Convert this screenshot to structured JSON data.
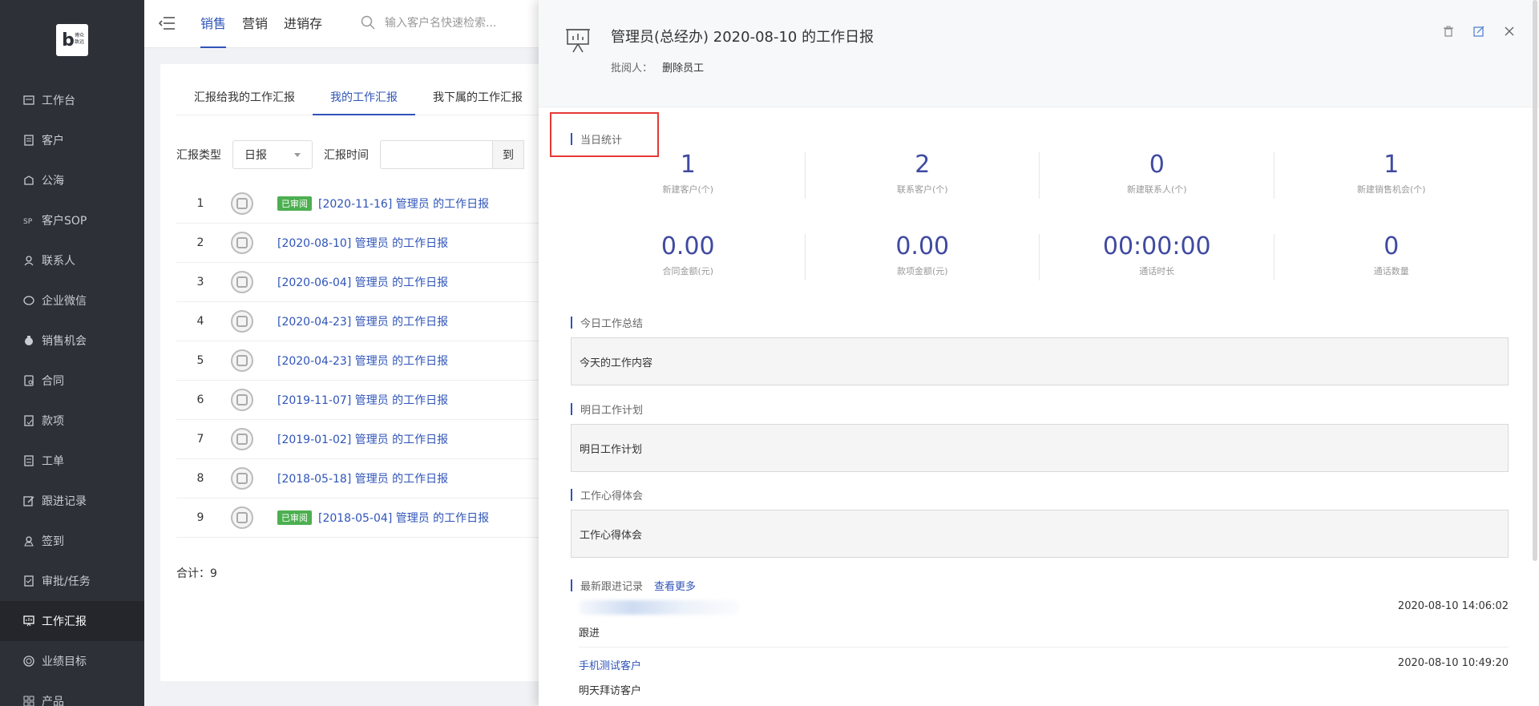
{
  "sidebar": {
    "logo_text": "博众致远",
    "items": [
      {
        "label": "工作台",
        "icon": "workbench-icon"
      },
      {
        "label": "客户",
        "icon": "customer-icon"
      },
      {
        "label": "公海",
        "icon": "pool-icon"
      },
      {
        "label": "客户SOP",
        "icon": "sop-icon"
      },
      {
        "label": "联系人",
        "icon": "contact-icon"
      },
      {
        "label": "企业微信",
        "icon": "wechat-icon"
      },
      {
        "label": "销售机会",
        "icon": "opportunity-icon"
      },
      {
        "label": "合同",
        "icon": "contract-icon"
      },
      {
        "label": "款项",
        "icon": "payment-icon"
      },
      {
        "label": "工单",
        "icon": "ticket-icon"
      },
      {
        "label": "跟进记录",
        "icon": "followup-icon"
      },
      {
        "label": "签到",
        "icon": "checkin-icon"
      },
      {
        "label": "审批/任务",
        "icon": "approval-icon"
      },
      {
        "label": "工作汇报",
        "icon": "report-icon"
      },
      {
        "label": "业绩目标",
        "icon": "target-icon"
      },
      {
        "label": "产品",
        "icon": "product-icon"
      }
    ],
    "active_index": 13
  },
  "topbar": {
    "tabs": [
      "销售",
      "营销",
      "进销存"
    ],
    "active_tab": 0,
    "search_placeholder": "输入客户名快速检索..."
  },
  "content": {
    "sub_tabs": [
      "汇报给我的工作汇报",
      "我的工作汇报",
      "我下属的工作汇报"
    ],
    "active_sub_tab": 1,
    "filter_type_label": "汇报类型",
    "filter_type_value": "日报",
    "filter_time_label": "汇报时间",
    "date_to": "到",
    "reports": [
      {
        "index": "1",
        "badge": "已审阅",
        "title": "[2020-11-16] 管理员 的工作日报"
      },
      {
        "index": "2",
        "badge": "",
        "title": "[2020-08-10] 管理员 的工作日报"
      },
      {
        "index": "3",
        "badge": "",
        "title": "[2020-06-04] 管理员 的工作日报"
      },
      {
        "index": "4",
        "badge": "",
        "title": "[2020-04-23] 管理员 的工作日报"
      },
      {
        "index": "5",
        "badge": "",
        "title": "[2020-04-23] 管理员 的工作日报"
      },
      {
        "index": "6",
        "badge": "",
        "title": "[2019-11-07] 管理员 的工作日报"
      },
      {
        "index": "7",
        "badge": "",
        "title": "[2019-01-02] 管理员 的工作日报"
      },
      {
        "index": "8",
        "badge": "",
        "title": "[2018-05-18] 管理员 的工作日报"
      },
      {
        "index": "9",
        "badge": "已审阅",
        "title": "[2018-05-04] 管理员 的工作日报"
      }
    ],
    "total": "合计：9"
  },
  "drawer": {
    "title": "管理员(总经办) 2020-08-10 的工作日报",
    "reviewer_label": "批阅人：",
    "reviewer_value": "删除员工",
    "actions": [
      "delete-icon",
      "edit-icon",
      "close-icon"
    ],
    "daily_stats_title": "当日统计",
    "stats_row1": [
      {
        "value": "1",
        "caption": "新建客户(个)"
      },
      {
        "value": "2",
        "caption": "联系客户(个)"
      },
      {
        "value": "0",
        "caption": "新建联系人(个)"
      },
      {
        "value": "1",
        "caption": "新建销售机会(个)"
      }
    ],
    "stats_row2": [
      {
        "value": "0.00",
        "caption": "合同金额(元)"
      },
      {
        "value": "0.00",
        "caption": "款项金额(元)"
      },
      {
        "value": "00:00:00",
        "caption": "通话时长"
      },
      {
        "value": "0",
        "caption": "通话数量"
      }
    ],
    "today_summary_title": "今日工作总结",
    "today_summary": "今天的工作内容",
    "tomorrow_plan_title": "明日工作计划",
    "tomorrow_plan": "明日工作计划",
    "insights_title": "工作心得体会",
    "insights": "工作心得体会",
    "records_title": "最新跟进记录",
    "records_more": "查看更多",
    "records": [
      {
        "customer": "",
        "time": "2020-08-10 14:06:02",
        "content": "跟进"
      },
      {
        "customer": "手机测试客户",
        "time": "2020-08-10 10:49:20",
        "content": "明天拜访客户"
      }
    ]
  },
  "colors": {
    "sidebar_bg": "#2d3037",
    "accent": "#2f54b8",
    "stat_number": "#3f4aa0",
    "badge_green": "#4caf50",
    "highlight_red": "#e53935"
  }
}
